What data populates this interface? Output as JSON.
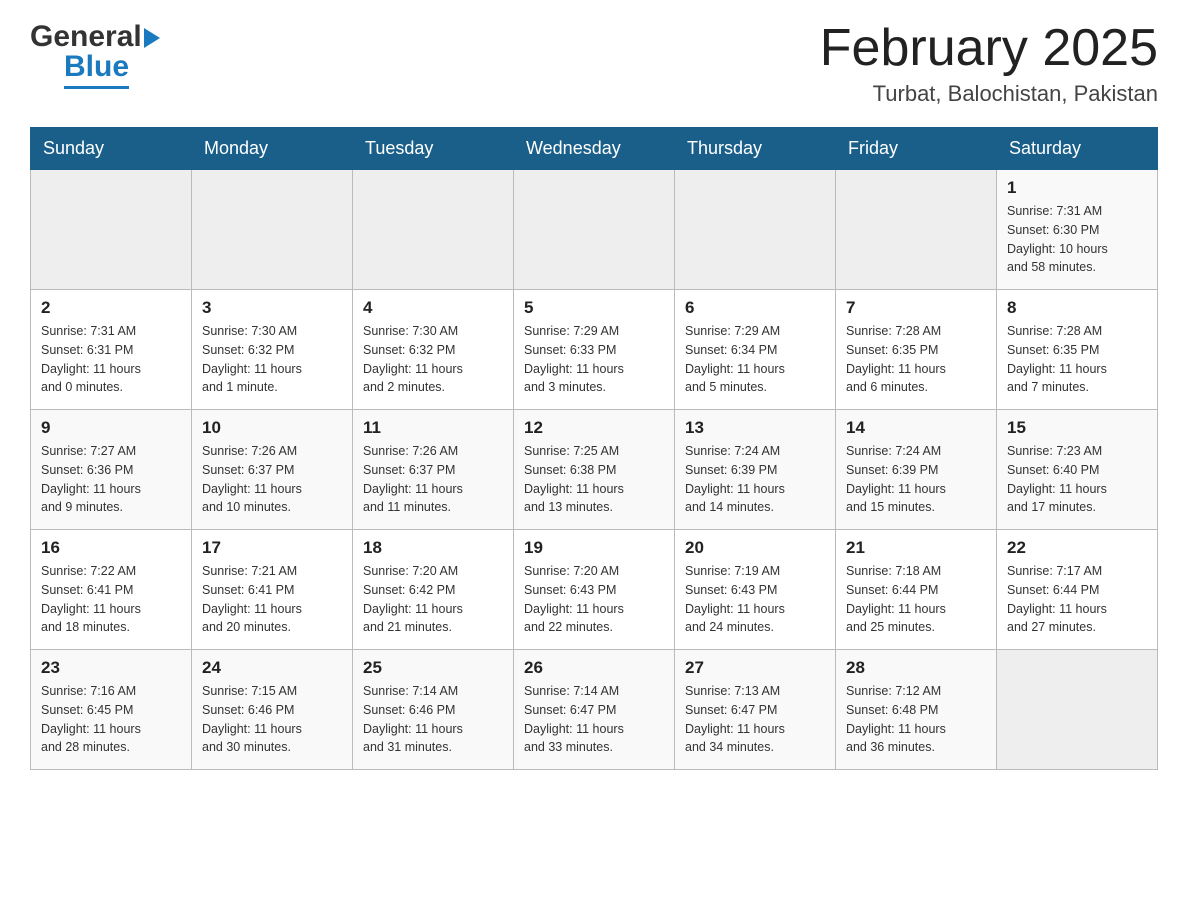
{
  "header": {
    "logo": {
      "general": "General",
      "blue": "Blue"
    },
    "title": "February 2025",
    "location": "Turbat, Balochistan, Pakistan"
  },
  "weekdays": [
    "Sunday",
    "Monday",
    "Tuesday",
    "Wednesday",
    "Thursday",
    "Friday",
    "Saturday"
  ],
  "weeks": [
    [
      {
        "day": "",
        "info": ""
      },
      {
        "day": "",
        "info": ""
      },
      {
        "day": "",
        "info": ""
      },
      {
        "day": "",
        "info": ""
      },
      {
        "day": "",
        "info": ""
      },
      {
        "day": "",
        "info": ""
      },
      {
        "day": "1",
        "info": "Sunrise: 7:31 AM\nSunset: 6:30 PM\nDaylight: 10 hours\nand 58 minutes."
      }
    ],
    [
      {
        "day": "2",
        "info": "Sunrise: 7:31 AM\nSunset: 6:31 PM\nDaylight: 11 hours\nand 0 minutes."
      },
      {
        "day": "3",
        "info": "Sunrise: 7:30 AM\nSunset: 6:32 PM\nDaylight: 11 hours\nand 1 minute."
      },
      {
        "day": "4",
        "info": "Sunrise: 7:30 AM\nSunset: 6:32 PM\nDaylight: 11 hours\nand 2 minutes."
      },
      {
        "day": "5",
        "info": "Sunrise: 7:29 AM\nSunset: 6:33 PM\nDaylight: 11 hours\nand 3 minutes."
      },
      {
        "day": "6",
        "info": "Sunrise: 7:29 AM\nSunset: 6:34 PM\nDaylight: 11 hours\nand 5 minutes."
      },
      {
        "day": "7",
        "info": "Sunrise: 7:28 AM\nSunset: 6:35 PM\nDaylight: 11 hours\nand 6 minutes."
      },
      {
        "day": "8",
        "info": "Sunrise: 7:28 AM\nSunset: 6:35 PM\nDaylight: 11 hours\nand 7 minutes."
      }
    ],
    [
      {
        "day": "9",
        "info": "Sunrise: 7:27 AM\nSunset: 6:36 PM\nDaylight: 11 hours\nand 9 minutes."
      },
      {
        "day": "10",
        "info": "Sunrise: 7:26 AM\nSunset: 6:37 PM\nDaylight: 11 hours\nand 10 minutes."
      },
      {
        "day": "11",
        "info": "Sunrise: 7:26 AM\nSunset: 6:37 PM\nDaylight: 11 hours\nand 11 minutes."
      },
      {
        "day": "12",
        "info": "Sunrise: 7:25 AM\nSunset: 6:38 PM\nDaylight: 11 hours\nand 13 minutes."
      },
      {
        "day": "13",
        "info": "Sunrise: 7:24 AM\nSunset: 6:39 PM\nDaylight: 11 hours\nand 14 minutes."
      },
      {
        "day": "14",
        "info": "Sunrise: 7:24 AM\nSunset: 6:39 PM\nDaylight: 11 hours\nand 15 minutes."
      },
      {
        "day": "15",
        "info": "Sunrise: 7:23 AM\nSunset: 6:40 PM\nDaylight: 11 hours\nand 17 minutes."
      }
    ],
    [
      {
        "day": "16",
        "info": "Sunrise: 7:22 AM\nSunset: 6:41 PM\nDaylight: 11 hours\nand 18 minutes."
      },
      {
        "day": "17",
        "info": "Sunrise: 7:21 AM\nSunset: 6:41 PM\nDaylight: 11 hours\nand 20 minutes."
      },
      {
        "day": "18",
        "info": "Sunrise: 7:20 AM\nSunset: 6:42 PM\nDaylight: 11 hours\nand 21 minutes."
      },
      {
        "day": "19",
        "info": "Sunrise: 7:20 AM\nSunset: 6:43 PM\nDaylight: 11 hours\nand 22 minutes."
      },
      {
        "day": "20",
        "info": "Sunrise: 7:19 AM\nSunset: 6:43 PM\nDaylight: 11 hours\nand 24 minutes."
      },
      {
        "day": "21",
        "info": "Sunrise: 7:18 AM\nSunset: 6:44 PM\nDaylight: 11 hours\nand 25 minutes."
      },
      {
        "day": "22",
        "info": "Sunrise: 7:17 AM\nSunset: 6:44 PM\nDaylight: 11 hours\nand 27 minutes."
      }
    ],
    [
      {
        "day": "23",
        "info": "Sunrise: 7:16 AM\nSunset: 6:45 PM\nDaylight: 11 hours\nand 28 minutes."
      },
      {
        "day": "24",
        "info": "Sunrise: 7:15 AM\nSunset: 6:46 PM\nDaylight: 11 hours\nand 30 minutes."
      },
      {
        "day": "25",
        "info": "Sunrise: 7:14 AM\nSunset: 6:46 PM\nDaylight: 11 hours\nand 31 minutes."
      },
      {
        "day": "26",
        "info": "Sunrise: 7:14 AM\nSunset: 6:47 PM\nDaylight: 11 hours\nand 33 minutes."
      },
      {
        "day": "27",
        "info": "Sunrise: 7:13 AM\nSunset: 6:47 PM\nDaylight: 11 hours\nand 34 minutes."
      },
      {
        "day": "28",
        "info": "Sunrise: 7:12 AM\nSunset: 6:48 PM\nDaylight: 11 hours\nand 36 minutes."
      },
      {
        "day": "",
        "info": ""
      }
    ]
  ]
}
